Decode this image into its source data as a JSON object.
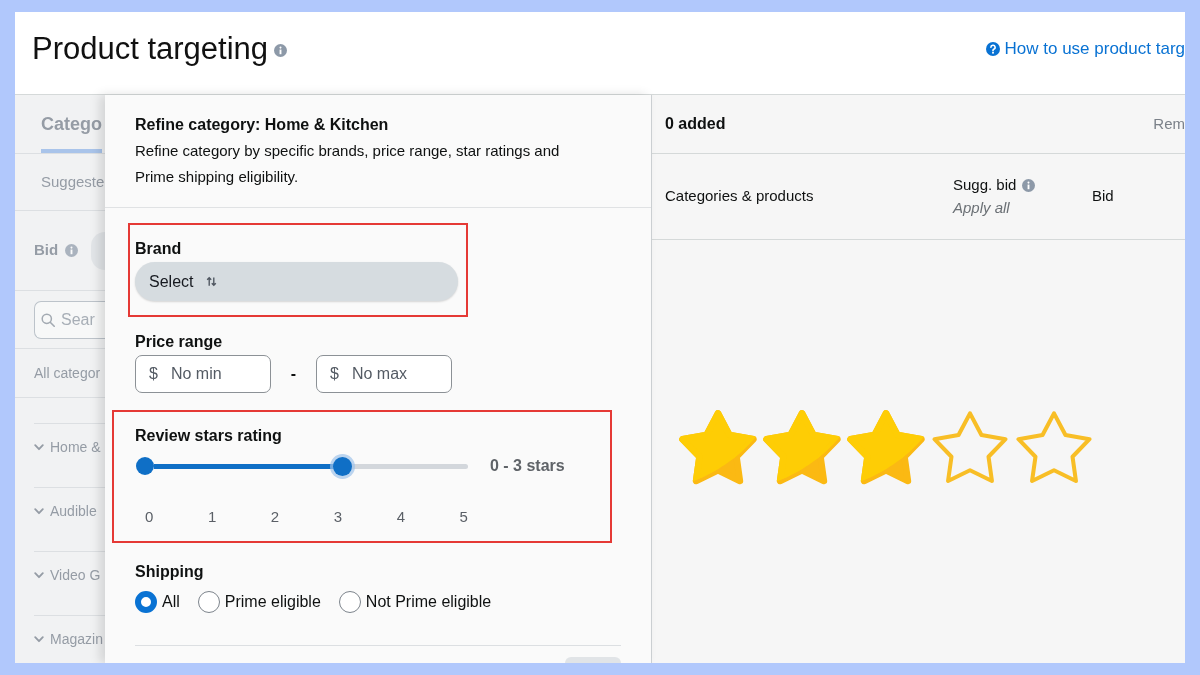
{
  "header": {
    "title": "Product targeting",
    "help_link": "How to use product targ"
  },
  "category_panel": {
    "tabs": [
      {
        "label": "Catego",
        "selected": true
      }
    ],
    "section_label": "Suggeste",
    "bid_label": "Bid",
    "search": {
      "placeholder": "Sear"
    },
    "breadcrumb": "All categor",
    "categories": [
      "Home &",
      "Audible",
      "Video G",
      "Magazin"
    ]
  },
  "refine_panel": {
    "title": "Refine category: Home & Kitchen",
    "description": "Refine category by specific brands, price range, star ratings and Prime shipping eligibility.",
    "brand": {
      "label": "Brand",
      "highlighted": true,
      "select": {
        "label": "Select"
      }
    },
    "price_range": {
      "label": "Price range",
      "min": {
        "prefix": "$",
        "placeholder": "No min"
      },
      "separator": "-",
      "max": {
        "prefix": "$",
        "placeholder": "No max"
      }
    },
    "rating": {
      "label": "Review stars rating",
      "highlighted": true,
      "slider": {
        "level": 0.6
      },
      "reading": "0 - 3 stars",
      "ticks": [
        "0",
        "1",
        "2",
        "3",
        "4",
        "5"
      ]
    },
    "shipping": {
      "label": "Shipping",
      "options": [
        {
          "label": "All",
          "selected": true
        },
        {
          "label": "Prime eligible",
          "selected": false
        },
        {
          "label": "Not Prime eligible",
          "selected": false
        }
      ]
    }
  },
  "added_panel": {
    "count": "0 added",
    "remove_link": "Rem",
    "columns": [
      {
        "label": "Categories & products"
      },
      {
        "label": "Sugg. bid",
        "action": "Apply all"
      },
      {
        "label": "Bid"
      }
    ]
  },
  "star_rating": {
    "stars": 3
  }
}
